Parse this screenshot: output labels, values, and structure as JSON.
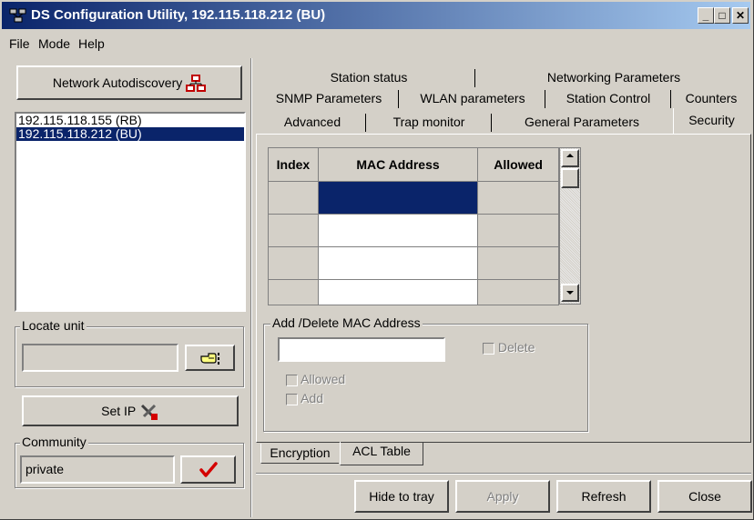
{
  "window": {
    "title": "DS Configuration Utility, 192.115.118.212  (BU)",
    "min_glyph": "_",
    "max_glyph": "□",
    "close_glyph": "✕"
  },
  "menu": {
    "file": "File",
    "mode": "Mode",
    "help": "Help"
  },
  "left": {
    "autodiscovery_label": "Network Autodiscovery",
    "devices": [
      "192.115.118.155  (RB)",
      "192.115.118.212  (BU)"
    ],
    "locate_unit_label": "Locate unit",
    "locate_value": "",
    "set_ip_label": "Set IP",
    "community_label": "Community",
    "community_value": "private"
  },
  "tabs": {
    "row1": [
      "Station status",
      "Networking Parameters"
    ],
    "row2": [
      "SNMP Parameters",
      "WLAN parameters",
      "Station Control",
      "Counters"
    ],
    "row3": [
      "Advanced",
      "Trap monitor",
      "General Parameters",
      "Security"
    ],
    "active": "Security"
  },
  "acl": {
    "headers": [
      "Index",
      "MAC Address",
      "Allowed"
    ],
    "rows": [
      {
        "index": "",
        "mac": "",
        "allowed": ""
      },
      {
        "index": "",
        "mac": "",
        "allowed": ""
      },
      {
        "index": "",
        "mac": "",
        "allowed": ""
      },
      {
        "index": "",
        "mac": "",
        "allowed": ""
      }
    ],
    "group_label": "Add /Delete MAC Address",
    "mac_input_value": "",
    "delete_label": "Delete",
    "allowed_label": "Allowed",
    "add_label": "Add"
  },
  "subtabs": [
    "Encryption",
    "ACL Table"
  ],
  "subtab_active": "ACL Table",
  "bottom": {
    "hide_label": "Hide to tray",
    "apply_label": "Apply",
    "refresh_label": "Refresh",
    "close_label": "Close"
  },
  "colors": {
    "titlebar_start": "#0a246a",
    "titlebar_end": "#a6caf0",
    "face": "#d4d0c8",
    "selection": "#0a246a",
    "checkmark": "#d40000"
  }
}
